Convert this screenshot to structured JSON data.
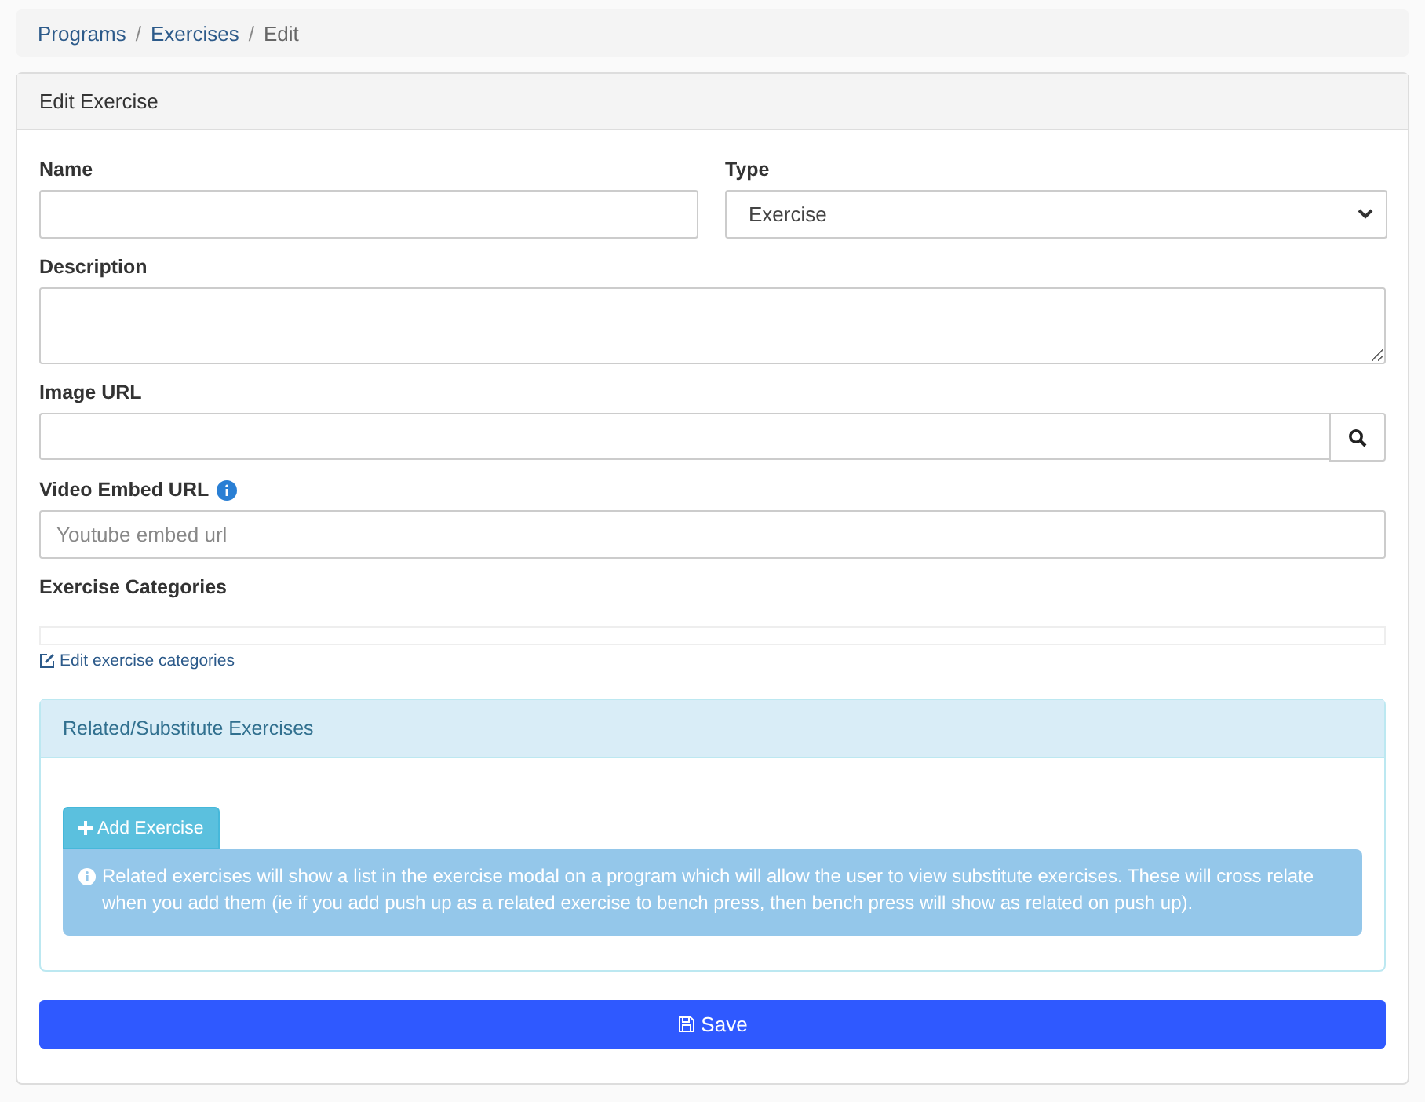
{
  "breadcrumb": {
    "separator": "/",
    "items": [
      {
        "label": "Programs",
        "kind": "link"
      },
      {
        "label": "Exercises",
        "kind": "link"
      },
      {
        "label": "Edit",
        "kind": "current"
      }
    ]
  },
  "card": {
    "title": "Edit Exercise"
  },
  "form": {
    "name": {
      "label": "Name"
    },
    "type": {
      "label": "Type",
      "value": "Exercise"
    },
    "description": {
      "label": "Description"
    },
    "image_url": {
      "label": "Image URL"
    },
    "video_url": {
      "label": "Video Embed URL",
      "placeholder": "Youtube embed url"
    },
    "categories": {
      "label": "Exercise Categories",
      "edit_link": "Edit exercise categories"
    }
  },
  "related": {
    "title": "Related/Substitute Exercises",
    "add_button": "Add Exercise",
    "info": "Related exercises will show a list in the exercise modal on a program which will allow the user to view substitute exercises. These will cross relate when you add them (ie if you add push up as a related exercise to bench press, then bench press will show as related on push up)."
  },
  "save_button": "Save"
}
